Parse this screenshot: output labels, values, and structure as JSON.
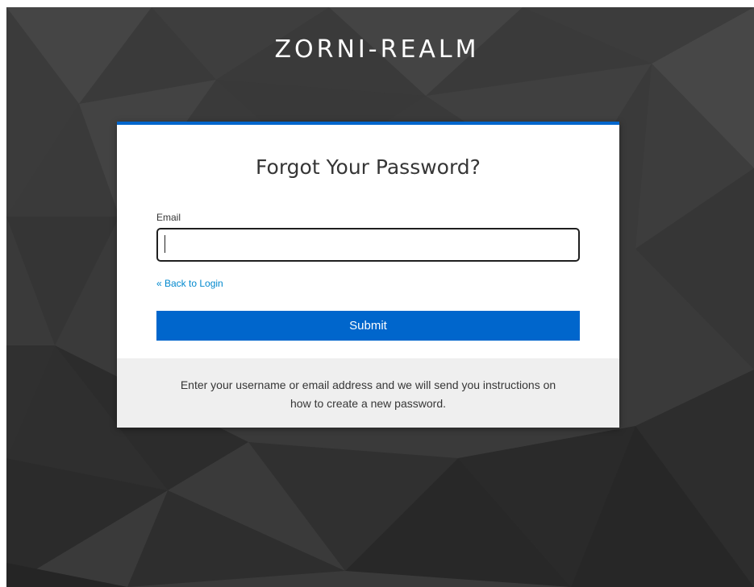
{
  "realm": {
    "title": "ZORNI-REALM"
  },
  "form": {
    "heading": "Forgot Your Password?",
    "email_label": "Email",
    "email_value": "",
    "back_link": "« Back to Login",
    "submit_label": "Submit"
  },
  "info": {
    "text": "Enter your username or email address and we will send you instructions on how to create a new password."
  },
  "colors": {
    "background": "#3a3a3a",
    "accent": "#0066cc",
    "link": "#0088ce",
    "info_background": "#efefef"
  }
}
